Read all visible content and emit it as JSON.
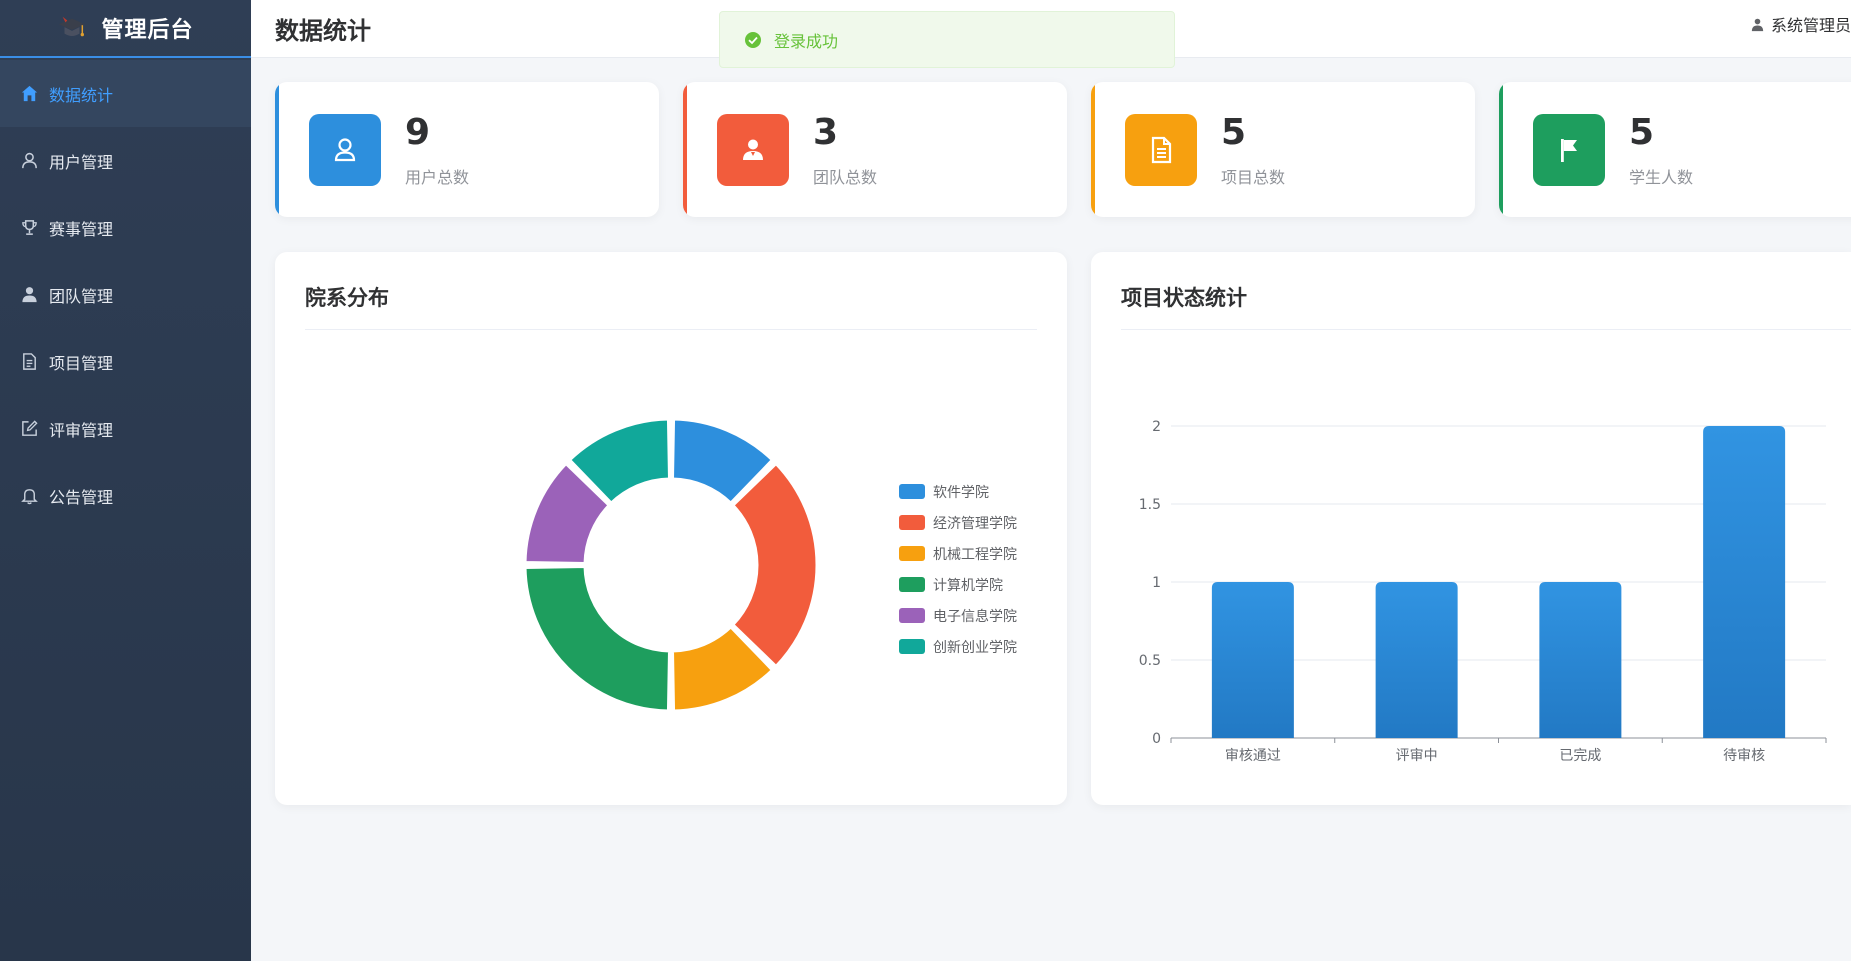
{
  "brand": {
    "title": "管理后台",
    "icon": "graduation-cap-icon"
  },
  "sidebar": {
    "items": [
      {
        "label": "数据统计",
        "icon": "home-icon",
        "active": true
      },
      {
        "label": "用户管理",
        "icon": "user-icon"
      },
      {
        "label": "赛事管理",
        "icon": "trophy-icon"
      },
      {
        "label": "团队管理",
        "icon": "team-icon"
      },
      {
        "label": "项目管理",
        "icon": "document-icon"
      },
      {
        "label": "评审管理",
        "icon": "edit-icon"
      },
      {
        "label": "公告管理",
        "icon": "bell-icon"
      }
    ]
  },
  "header": {
    "title": "数据统计",
    "user": "系统管理员",
    "user_icon": "user-icon"
  },
  "toast": {
    "text": "登录成功",
    "icon": "check-circle-icon",
    "color": "#67c23a"
  },
  "stats": [
    {
      "value": "9",
      "label": "用户总数",
      "color": "#2d8fdd",
      "icon": "user-icon"
    },
    {
      "value": "3",
      "label": "团队总数",
      "color": "#f25c3c",
      "icon": "team-icon"
    },
    {
      "value": "5",
      "label": "项目总数",
      "color": "#f7a00f",
      "icon": "document-icon"
    },
    {
      "value": "5",
      "label": "学生人数",
      "color": "#1e9e5e",
      "icon": "flag-icon"
    }
  ],
  "panels": {
    "pie_title": "院系分布",
    "bar_title": "项目状态统计"
  },
  "chart_data": [
    {
      "type": "pie",
      "title": "院系分布",
      "categories": [
        "软件学院",
        "经济管理学院",
        "机械工程学院",
        "计算机学院",
        "电子信息学院",
        "创新创业学院"
      ],
      "values": [
        1,
        2,
        1,
        2,
        1,
        1
      ],
      "colors": [
        "#2d8fdd",
        "#f25c3c",
        "#f7a00f",
        "#1e9e5e",
        "#9b62b9",
        "#11a89a"
      ],
      "donut": true,
      "legend": "right"
    },
    {
      "type": "bar",
      "title": "项目状态统计",
      "categories": [
        "审核通过",
        "评审中",
        "已完成",
        "待审核"
      ],
      "values": [
        1,
        1,
        1,
        2
      ],
      "ylim": [
        0,
        2
      ],
      "yticks": [
        "0",
        "0.5",
        "1",
        "1.5",
        "2"
      ],
      "color": "#2d8fdd",
      "grid": true
    }
  ]
}
